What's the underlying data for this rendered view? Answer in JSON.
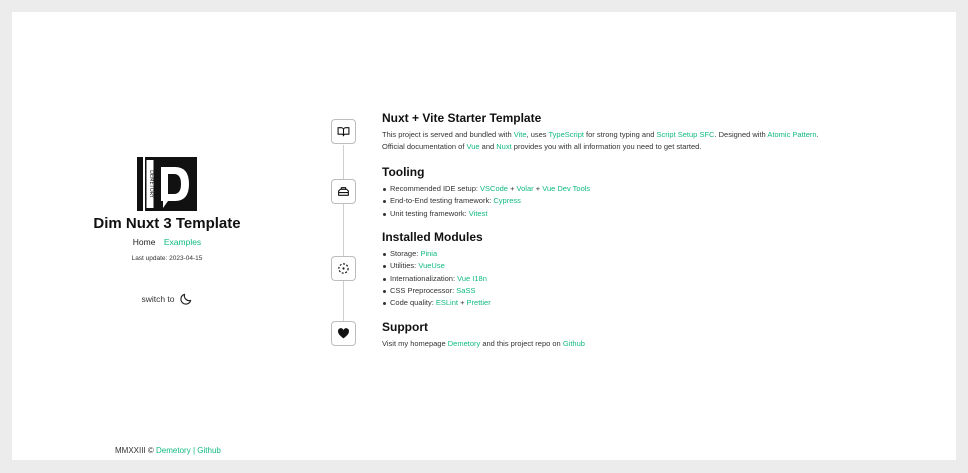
{
  "sidebar": {
    "logo_letter": "D",
    "logo_vertical_text": "DEMETORY",
    "title": "Dim Nuxt 3 Template",
    "nav": {
      "home": "Home",
      "examples": "Examples"
    },
    "last_update": "Last update: 2023-04-15",
    "switch_label": "switch to",
    "switch_icon": "moon-icon"
  },
  "footer": {
    "prefix": "MMXXIII ©",
    "demetory": "Demetory",
    "separator": "|",
    "github": "Github"
  },
  "sections": {
    "intro": {
      "icon": "book-icon",
      "title": "Nuxt + Vite Starter Template",
      "line1": {
        "t1": "This project is served and bundled with ",
        "vite": "Vite",
        "t2": ", uses ",
        "typescript": "TypeScript",
        "t3": " for strong typing and ",
        "script_setup": "Script Setup SFC",
        "t4": ". Designed with ",
        "atomic": "Atomic Pattern",
        "t5": "."
      },
      "line2": {
        "t1": "Official documentation of ",
        "vue": "Vue",
        "t2": " and ",
        "nuxt": "Nuxt",
        "t3": " provides you with all information you need to get started."
      }
    },
    "tooling": {
      "icon": "toolbox-icon",
      "title": "Tooling",
      "ide": {
        "label": "Recommended IDE setup: ",
        "vscode": "VSCode",
        "plus1": " + ",
        "volar": "Volar",
        "plus2": " + ",
        "devtools": "Vue Dev Tools"
      },
      "e2e": {
        "label": "End-to-End testing framework: ",
        "cypress": "Cypress"
      },
      "unit": {
        "label": "Unit testing framework: ",
        "vitest": "Vitest"
      }
    },
    "modules": {
      "icon": "modules-icon",
      "title": "Installed Modules",
      "storage": {
        "label": "Storage: ",
        "link": "Pinia"
      },
      "utilities": {
        "label": "Utilities: ",
        "link": "VueUse"
      },
      "i18n": {
        "label": "Internationalization: ",
        "link": "Vue I18n"
      },
      "css": {
        "label": "CSS Preprocessor: ",
        "link": "SaSS"
      },
      "quality": {
        "label": "Code quality: ",
        "eslint": "ESLint",
        "plus": " + ",
        "prettier": "Prettier"
      }
    },
    "support": {
      "icon": "heart-icon",
      "title": "Support",
      "line": {
        "t1": "Visit my homepage ",
        "demetory": "Demetory",
        "t2": " and this project repo on ",
        "github": "Github"
      }
    }
  },
  "colors": {
    "accent": "#10b981",
    "background": "#ececec",
    "card": "#ffffff"
  }
}
